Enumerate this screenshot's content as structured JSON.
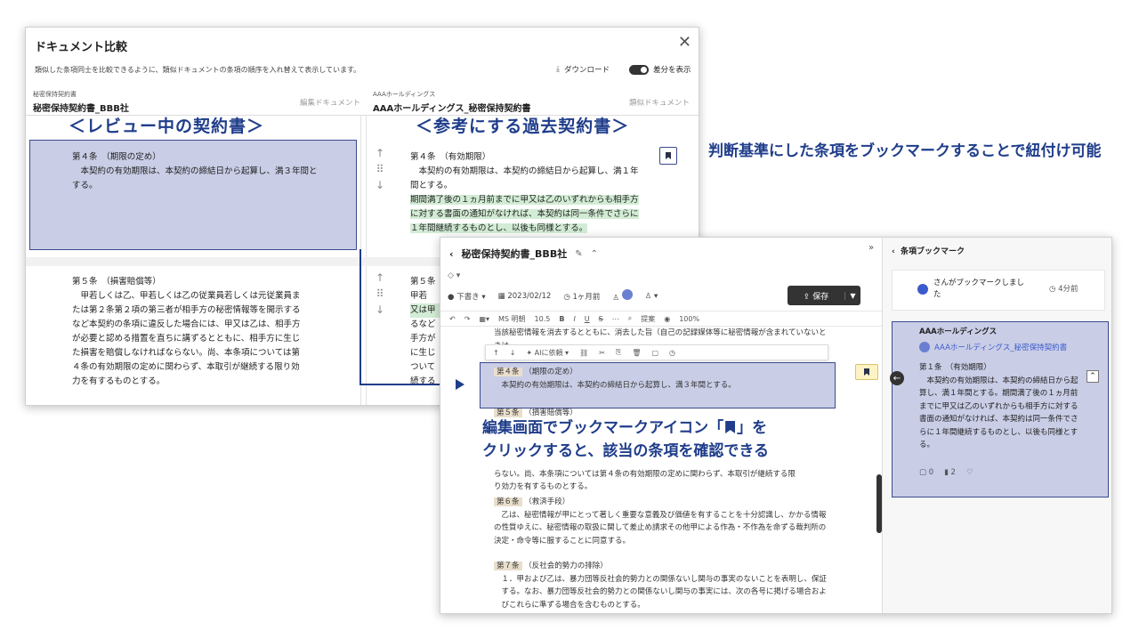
{
  "compare": {
    "title": "ドキュメント比較",
    "description": "類似した条項同士を比較できるように、類似ドキュメントの条項の順序を入れ替えて表示しています。",
    "download_label": "ダウンロード",
    "diff_toggle_label": "差分を表示",
    "left_doc": {
      "category": "秘密保持契約書",
      "name": "秘密保持契約書_BBB社",
      "tag": "編集ドキュメント",
      "caption": "＜レビュー中の契約書＞"
    },
    "right_doc": {
      "category": "AAAホールディングス",
      "name": "AAAホールディングス_秘密保持契約書",
      "tag": "類似ドキュメント",
      "caption": "＜参考にする過去契約書＞"
    },
    "left_art4": {
      "head": "第４条　（期限の定め）",
      "body": "本契約の有効期限は、本契約の締結日から起算し、満３年間とする。"
    },
    "right_art4": {
      "head": "第４条　（有効期限）",
      "body1": "本契約の有効期限は、本契約の締結日から起算し、満１年間とする。",
      "body2": "期間満了後の１ヵ月前までに甲又は乙のいずれからも相手方に対する書面の通知がなければ、本契約は同一条件でさらに１年間継続するものとし、以後も同様とする。"
    },
    "left_art5": {
      "head": "第５条　（損害賠償等）",
      "body": "甲若しくは乙、甲若しくは乙の従業員若しくは元従業員または第２条第２項の第三者が相手方の秘密情報等を開示するなど本契約の条項に違反した場合には、甲又は乙は、相手方が必要と認める措置を直ちに講ずるとともに、相手方に生じた損害を賠償しなければならない。尚、本条項については第４条の有効期限の定めに関わらず、本取引が継続する限り効力を有するものとする。"
    },
    "right_art5_head": "第５条",
    "right_art5_fragments": [
      "甲若",
      "又は甲",
      "るなど",
      "手方が",
      "に生じ",
      "ついて",
      "続する"
    ]
  },
  "annotations": {
    "bookmark_note": "判断基準にした条項をブックマークすることで紐付け可能",
    "edit_note_1": "編集画面でブックマークアイコン「",
    "edit_note_2": "」を",
    "edit_note_3": "クリックすると、該当の条項を確認できる"
  },
  "editor": {
    "doc_title": "秘密保持契約書_BBB社",
    "status": "下書き",
    "date": "2023/02/12",
    "ago": "1ヶ月前",
    "save_label": "保存",
    "toolbar": [
      "MS 明朝",
      "10.5",
      "B",
      "I",
      "U",
      "S",
      "提案",
      "100%"
    ],
    "float_toolbar_label": "AIに依頼",
    "prev_text": "当該秘密情報を消去するとともに、消去した旨（自己の記録媒体等に秘密情報が含まれていないときは、…",
    "art4_head": "第４条",
    "art4_title": "（期限の定め）",
    "art4_body": "本契約の有効期限は、本契約の締結日から起算し、満３年間とする。",
    "art5_head": "第５条",
    "art5_title": "（損害賠償等）",
    "art5_tail1": "らない。尚、本条項については第４条の有効期限の定めに関わらず、本取引が継続する限",
    "art5_tail2": "り効力を有するものとする。",
    "art6_head": "第６条",
    "art6_title": "（救済手段）",
    "art6_body": "乙は、秘密情報が甲にとって著しく重要な意義及び価値を有することを十分認識し、かかる情報の性質ゆえに、秘密情報の取扱に関して差止め請求その他甲による作為・不作為を命ずる裁判所の決定・命令等に服することに同意する。",
    "art7_head": "第７条",
    "art7_title": "（反社会的勢力の排除）",
    "art7_body": "１．甲および乙は、暴力団等反社会的勢力との関係ないし関与の事実のないことを表明し、保証する。なお、暴力団等反社会的勢力との関係ないし関与の事実には、次の各号に掲げる場合およびこれらに準ずる場合を含むものとする。"
  },
  "bookmark_panel": {
    "title": "条項ブックマーク",
    "activity": "さんがブックマークしました",
    "activity_time": "4分前",
    "company": "AAAホールディングス",
    "doc_link": "AAAホールディングス_秘密保持契約書",
    "clause_head": "第１条　（有効期限）",
    "clause_body": "本契約の有効期限は、本契約の締結日から起算し、満１年間とする。期間満了後の１ヵ月前までに甲又は乙のいずれからも相手方に対する書面の通知がなければ、本契約は同一条件でさらに１年間継続するものとし、以後も同様とする。",
    "comments": "0",
    "bookmarks": "2"
  },
  "colors": {
    "accent": "#1f3d8a",
    "highlight": "#c9cde6",
    "deleted": "#f6d3d6",
    "added": "#d3ecd5"
  }
}
